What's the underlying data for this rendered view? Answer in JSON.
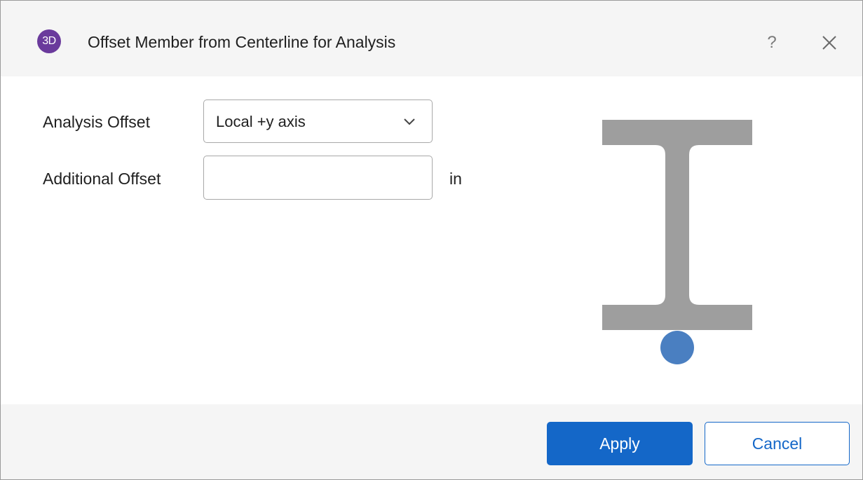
{
  "dialog": {
    "app_badge": "3D",
    "title": "Offset Member from Centerline for Analysis",
    "help_label": "?"
  },
  "form": {
    "analysis_offset": {
      "label": "Analysis Offset",
      "selected_value": "Local +y axis"
    },
    "additional_offset": {
      "label": "Additional Offset",
      "value": "",
      "unit": "in"
    }
  },
  "diagram": {
    "shape": "i-beam-section",
    "offset_location": "bottom",
    "colors": {
      "section": "#9e9e9e",
      "offset_point": "#4a7fc1"
    }
  },
  "footer": {
    "apply_label": "Apply",
    "cancel_label": "Cancel"
  },
  "colors": {
    "accent": "#1467c8",
    "app_badge": "#6a3a9c",
    "title_bar": "#f5f5f5"
  },
  "icons": [
    "app-logo-icon",
    "help-icon",
    "close-icon",
    "chevron-down-icon"
  ]
}
